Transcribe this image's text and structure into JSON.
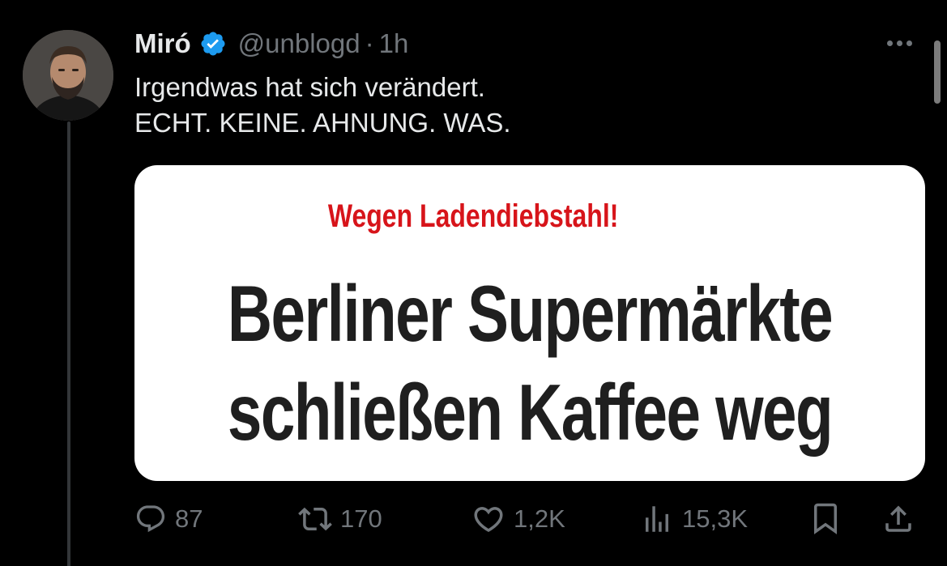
{
  "tweet": {
    "author_name": "Miró",
    "handle": "@unblogd",
    "separator": "·",
    "time": "1h",
    "text_lines": [
      "Irgendwas hat sich verändert.",
      "ECHT. KEINE. AHNUNG. WAS."
    ],
    "media": {
      "kicker": "Wegen Ladendiebstahl!",
      "headline_lines": [
        "Berliner Supermärkte",
        "schließen Kaffee weg"
      ]
    },
    "stats": {
      "replies": "87",
      "retweets": "170",
      "likes": "1,2K",
      "views": "15,3K"
    }
  },
  "colors": {
    "background": "#000000",
    "verified_badge": "#1d9bf0",
    "kicker_red": "#d7141a",
    "muted_text": "#71767b"
  },
  "icons": [
    "verified-badge-icon",
    "more-dots-icon",
    "reply-icon",
    "retweet-icon",
    "like-icon",
    "views-icon",
    "bookmark-icon",
    "share-icon"
  ]
}
